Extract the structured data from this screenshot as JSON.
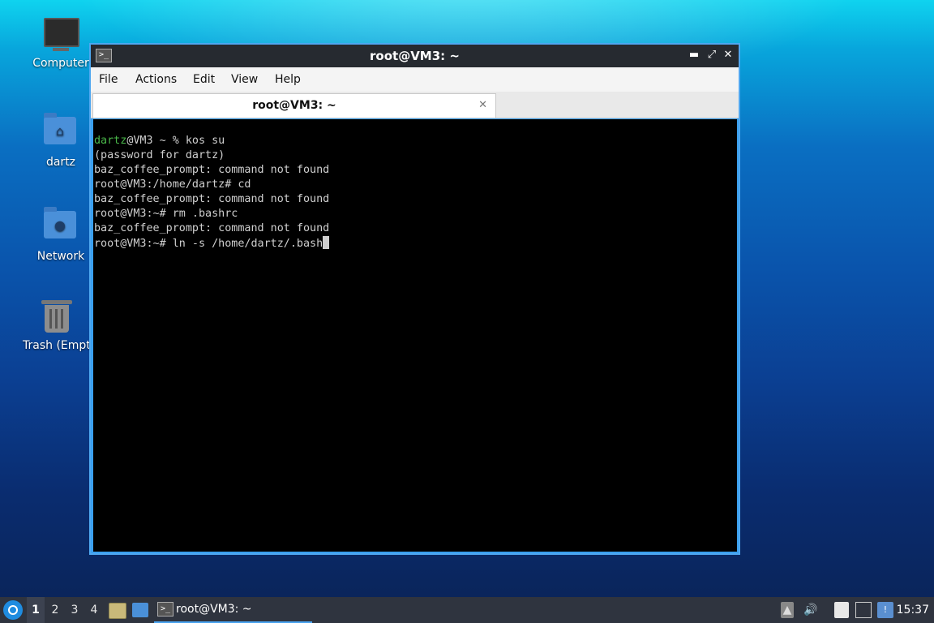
{
  "desktop": {
    "icons": [
      {
        "label": "Computer",
        "icon": "computer-icon"
      },
      {
        "label": "dartz",
        "icon": "home-folder-icon"
      },
      {
        "label": "Network",
        "icon": "network-folder-icon"
      },
      {
        "label": "Trash (Empt",
        "icon": "trash-icon"
      }
    ]
  },
  "window": {
    "title": "root@VM3: ~",
    "controls": {
      "minimize": "▬",
      "maximize": "⤢",
      "close": "✕"
    },
    "menu": [
      "File",
      "Actions",
      "Edit",
      "View",
      "Help"
    ],
    "tab": {
      "label": "root@VM3: ~",
      "close": "✕"
    }
  },
  "terminal": {
    "lines": [
      {
        "user": "dartz",
        "rest": "@VM3 ~ % kos su"
      },
      {
        "text": "(password for dartz)"
      },
      {
        "text": "baz_coffee_prompt: command not found"
      },
      {
        "text": "root@VM3:/home/dartz# cd"
      },
      {
        "text": "baz_coffee_prompt: command not found"
      },
      {
        "text": "root@VM3:~# rm .bashrc"
      },
      {
        "text": "baz_coffee_prompt: command not found"
      },
      {
        "text": "root@VM3:~# ln -s /home/dartz/.bash"
      }
    ],
    "colors": {
      "background": "#000000",
      "foreground": "#cfcfcf",
      "user": "#4ab84a"
    }
  },
  "taskbar": {
    "workspaces": [
      "1",
      "2",
      "3",
      "4"
    ],
    "active_workspace": "1",
    "task_label": "root@VM3: ~",
    "clock": "15:37",
    "tray_icons": [
      "up-arrow-icon",
      "volume-icon",
      "clipboard-icon",
      "network-icon",
      "update-notifier-icon"
    ]
  }
}
